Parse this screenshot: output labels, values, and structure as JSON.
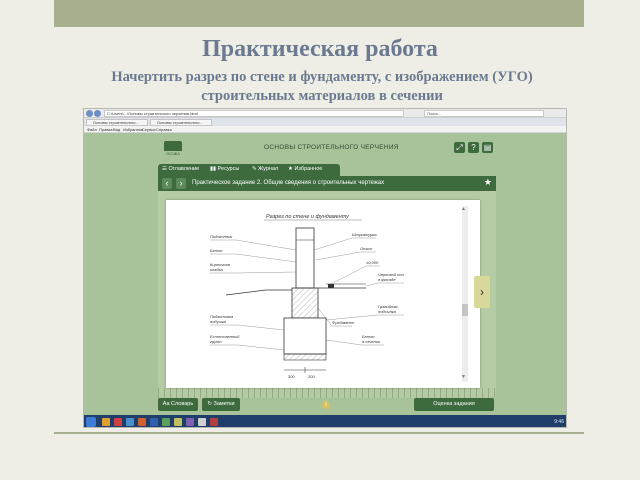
{
  "slide": {
    "title": "Практическая работа",
    "subtitle": "Начертить  разрез по стене и фундаменту, с изображением (УГО) строительных материалов в сечении"
  },
  "browser": {
    "address": "C:\\Users\\...\\Основы строительного черчения.html",
    "search_placeholder": "Поиск...",
    "tabs": [
      {
        "label": "Основы строительного..."
      },
      {
        "label": "Основы строительного..."
      }
    ],
    "menu": [
      "Файл",
      "Правка",
      "Вид",
      "Избранное",
      "Сервис",
      "Справка"
    ]
  },
  "app": {
    "logo_text": "ОСЧБА",
    "title": "ОСНОВЫ СТРОИТЕЛЬНОГО ЧЕРЧЕНИЯ",
    "tabs": [
      {
        "label": "Оглавление"
      },
      {
        "label": "Ресурсы"
      },
      {
        "label": "Журнал"
      },
      {
        "label": "Избранное"
      }
    ],
    "corner_buttons": [
      "⤢",
      "?",
      "▤"
    ],
    "panel_title": "Практическое задание 2. Общие сведения о строительных чертежах",
    "bottom_left": {
      "dictionary": "Словарь",
      "notes": "Заметки"
    },
    "bottom_right": "Оценка задания"
  },
  "drawing": {
    "title": "Разрез по стене и фундаменту",
    "labels": {
      "opening": "Подоконник",
      "conc1": "Бетон",
      "brick1": "Кирпичная",
      "brick2": "кладка",
      "plaster": "Штукатурка",
      "slope": "Откос",
      "zero": "±0,000",
      "slab1": "Черновой пол",
      "slab2": "в фасаде",
      "prep1": "Подготовка",
      "prep2": "подушка",
      "fill1": "Гравийная",
      "fill2": "подсыпка",
      "soil1": "Естественный",
      "soil2": "грунт",
      "found": "Фундамент",
      "conc2a": "Бетон",
      "conc2b": "в сечении",
      "dim1": "300",
      "dim2": "200"
    }
  },
  "taskbar": {
    "clock": "9:46"
  }
}
